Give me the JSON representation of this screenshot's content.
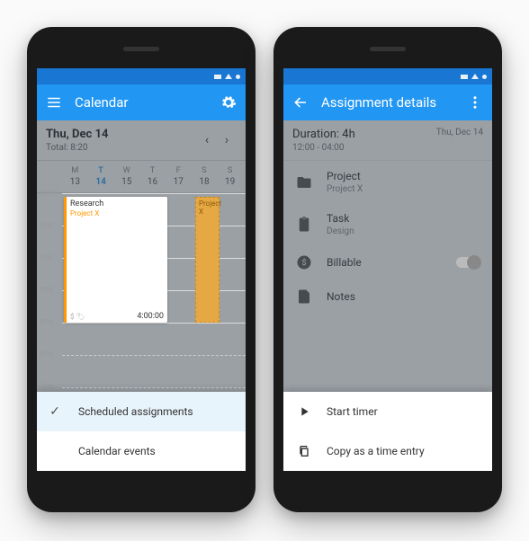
{
  "left": {
    "appbar": {
      "title": "Calendar"
    },
    "date": "Thu, Dec 14",
    "total_label": "Total: 8:20",
    "days": [
      {
        "dow": "M",
        "num": "13"
      },
      {
        "dow": "T",
        "num": "14",
        "active": true
      },
      {
        "dow": "W",
        "num": "15"
      },
      {
        "dow": "T",
        "num": "16"
      },
      {
        "dow": "F",
        "num": "17"
      },
      {
        "dow": "S",
        "num": "18"
      },
      {
        "dow": "S",
        "num": "19"
      }
    ],
    "hours": [
      "12PM",
      "1PM",
      "2PM",
      "3PM",
      "4PM",
      "5PM",
      "6PM"
    ],
    "event": {
      "name": "Research",
      "project": "Project X",
      "time": "4:00:00"
    },
    "slot": {
      "label": "Project X"
    },
    "sheet": {
      "scheduled": "Scheduled assignments",
      "calendar": "Calendar events"
    }
  },
  "right": {
    "appbar": {
      "title": "Assignment details"
    },
    "header": {
      "duration": "Duration: 4h",
      "range": "12:00 - 04:00",
      "date": "Thu, Dec 14"
    },
    "rows": {
      "project": {
        "label": "Project",
        "value": "Project X"
      },
      "task": {
        "label": "Task",
        "value": "Design"
      },
      "billable": {
        "label": "Billable"
      },
      "notes": {
        "label": "Notes"
      }
    },
    "sheet": {
      "start": "Start timer",
      "copy": "Copy as a time entry"
    }
  }
}
